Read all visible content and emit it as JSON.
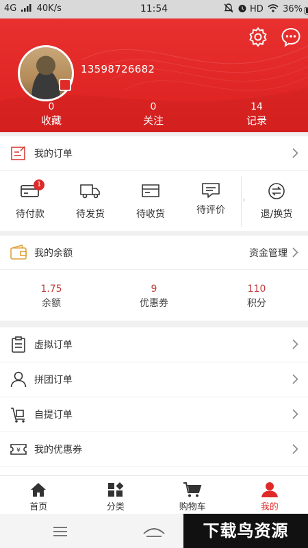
{
  "status_bar": {
    "network": "4G",
    "speed": "40K/s",
    "time": "11:54",
    "hd": "HD",
    "battery": "36%"
  },
  "profile": {
    "phone": "13598726682",
    "stats": [
      {
        "value": "0",
        "label": "收藏"
      },
      {
        "value": "0",
        "label": "关注"
      },
      {
        "value": "14",
        "label": "记录"
      }
    ]
  },
  "orders": {
    "title": "我的订单",
    "items": [
      {
        "label": "待付款",
        "badge": "1",
        "icon": "wallet-card-icon"
      },
      {
        "label": "待发货",
        "icon": "truck-icon"
      },
      {
        "label": "待收货",
        "icon": "package-icon"
      },
      {
        "label": "待评价",
        "icon": "comment-icon"
      },
      {
        "label": "退/换货",
        "icon": "exchange-icon"
      }
    ]
  },
  "wallet": {
    "title": "我的余额",
    "manage": "资金管理",
    "items": [
      {
        "value": "1.75",
        "label": "余额"
      },
      {
        "value": "9",
        "label": "优惠券"
      },
      {
        "value": "110",
        "label": "积分"
      }
    ]
  },
  "menu": [
    {
      "label": "虚拟订单",
      "icon": "clipboard-icon"
    },
    {
      "label": "拼团订单",
      "icon": "user-icon"
    },
    {
      "label": "自提订单",
      "icon": "pickup-cart-icon"
    },
    {
      "label": "我的优惠券",
      "icon": "coupon-icon"
    }
  ],
  "tabs": [
    {
      "label": "首页",
      "icon": "home-icon"
    },
    {
      "label": "分类",
      "icon": "category-icon"
    },
    {
      "label": "购物车",
      "icon": "cart-icon"
    },
    {
      "label": "我的",
      "icon": "profile-icon",
      "active": true
    }
  ],
  "watermark": "下载鸟资源",
  "colors": {
    "brand_red": "#e02a2a",
    "header_red": "#e32b2a",
    "value_red": "#c23a3a"
  }
}
